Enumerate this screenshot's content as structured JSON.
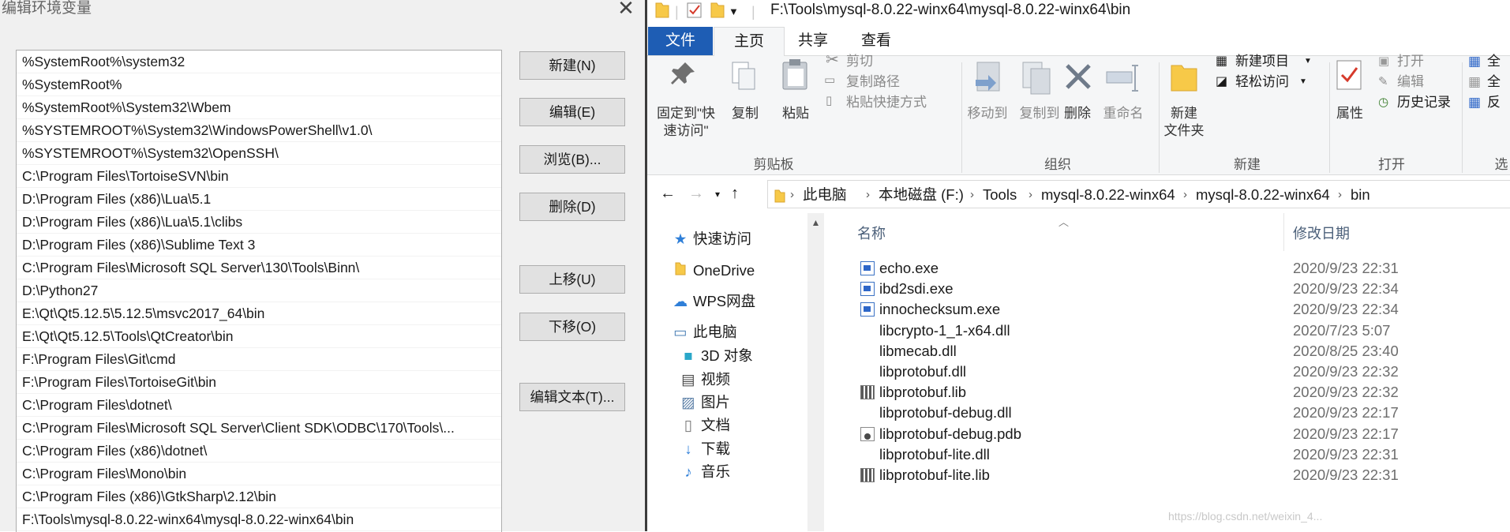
{
  "dialog": {
    "title": "编辑环境变量",
    "close": "✕",
    "paths": [
      "%SystemRoot%\\system32",
      "%SystemRoot%",
      "%SystemRoot%\\System32\\Wbem",
      "%SYSTEMROOT%\\System32\\WindowsPowerShell\\v1.0\\",
      "%SYSTEMROOT%\\System32\\OpenSSH\\",
      "C:\\Program Files\\TortoiseSVN\\bin",
      "D:\\Program Files (x86)\\Lua\\5.1",
      "D:\\Program Files (x86)\\Lua\\5.1\\clibs",
      "D:\\Program Files (x86)\\Sublime Text 3",
      "C:\\Program Files\\Microsoft SQL Server\\130\\Tools\\Binn\\",
      "D:\\Python27",
      "E:\\Qt\\Qt5.12.5\\5.12.5\\msvc2017_64\\bin",
      "E:\\Qt\\Qt5.12.5\\Tools\\QtCreator\\bin",
      "F:\\Program Files\\Git\\cmd",
      "F:\\Program Files\\TortoiseGit\\bin",
      "C:\\Program Files\\dotnet\\",
      "C:\\Program Files\\Microsoft SQL Server\\Client SDK\\ODBC\\170\\Tools\\...",
      "C:\\Program Files (x86)\\dotnet\\",
      "C:\\Program Files\\Mono\\bin",
      "C:\\Program Files (x86)\\GtkSharp\\2.12\\bin",
      "F:\\Tools\\mysql-8.0.22-winx64\\mysql-8.0.22-winx64\\bin"
    ],
    "buttons": {
      "new": "新建(N)",
      "edit": "编辑(E)",
      "browse": "浏览(B)...",
      "delete": "删除(D)",
      "move_up": "上移(U)",
      "move_down": "下移(O)",
      "edit_text": "编辑文本(T)..."
    }
  },
  "explorer": {
    "title_path": "F:\\Tools\\mysql-8.0.22-winx64\\mysql-8.0.22-winx64\\bin",
    "tabs": {
      "file": "文件",
      "home": "主页",
      "share": "共享",
      "view": "查看"
    },
    "ribbon": {
      "pin": "固定到\"快速访问\"",
      "copy": "复制",
      "paste": "粘贴",
      "cut": "剪切",
      "copy_path": "复制路径",
      "paste_shortcut": "粘贴快捷方式",
      "clipboard_group": "剪贴板",
      "move_to": "移动到",
      "copy_to": "复制到",
      "delete": "删除",
      "rename": "重命名",
      "organize_group": "组织",
      "new_folder": "新建\n文件夹",
      "new_item": "新建项目",
      "easy_access": "轻松访问",
      "new_group": "新建",
      "properties": "属性",
      "open": "打开",
      "edit": "编辑",
      "history": "历史记录",
      "open_group": "打开",
      "select_all": "全",
      "select_none": "全",
      "invert": "反",
      "select_group": "选"
    },
    "breadcrumb": [
      "此电脑",
      "本地磁盘 (F:)",
      "Tools",
      "mysql-8.0.22-winx64",
      "mysql-8.0.22-winx64",
      "bin"
    ],
    "nav": [
      {
        "label": "快速访问",
        "icon": "star-icon"
      },
      {
        "label": "OneDrive",
        "icon": "folder-icon"
      },
      {
        "label": "WPS网盘",
        "icon": "cloud-icon"
      },
      {
        "label": "此电脑",
        "icon": "computer-icon"
      },
      {
        "label": "3D 对象",
        "icon": "cube-icon"
      },
      {
        "label": "视频",
        "icon": "video-icon"
      },
      {
        "label": "图片",
        "icon": "picture-icon"
      },
      {
        "label": "文档",
        "icon": "document-icon"
      },
      {
        "label": "下载",
        "icon": "download-icon"
      },
      {
        "label": "音乐",
        "icon": "music-icon"
      }
    ],
    "columns": {
      "name": "名称",
      "date": "修改日期"
    },
    "files": [
      {
        "name": "echo.exe",
        "date": "2020/9/23 22:31",
        "type": "exe"
      },
      {
        "name": "ibd2sdi.exe",
        "date": "2020/9/23 22:34",
        "type": "exe"
      },
      {
        "name": "innochecksum.exe",
        "date": "2020/9/23 22:34",
        "type": "exe"
      },
      {
        "name": "libcrypto-1_1-x64.dll",
        "date": "2020/7/23 5:07",
        "type": "dll"
      },
      {
        "name": "libmecab.dll",
        "date": "2020/8/25 23:40",
        "type": "dll"
      },
      {
        "name": "libprotobuf.dll",
        "date": "2020/9/23 22:32",
        "type": "dll"
      },
      {
        "name": "libprotobuf.lib",
        "date": "2020/9/23 22:32",
        "type": "lib"
      },
      {
        "name": "libprotobuf-debug.dll",
        "date": "2020/9/23 22:17",
        "type": "dll"
      },
      {
        "name": "libprotobuf-debug.pdb",
        "date": "2020/9/23 22:17",
        "type": "pdb"
      },
      {
        "name": "libprotobuf-lite.dll",
        "date": "2020/9/23 22:31",
        "type": "dll"
      },
      {
        "name": "libprotobuf-lite.lib",
        "date": "2020/9/23 22:31",
        "type": "lib"
      }
    ],
    "watermark": "https://blog.csdn.net/weixin_4..."
  },
  "colors": {
    "accent": "#1e5db4",
    "folder": "#f7c948",
    "exe_icon": "#2d66c8"
  }
}
